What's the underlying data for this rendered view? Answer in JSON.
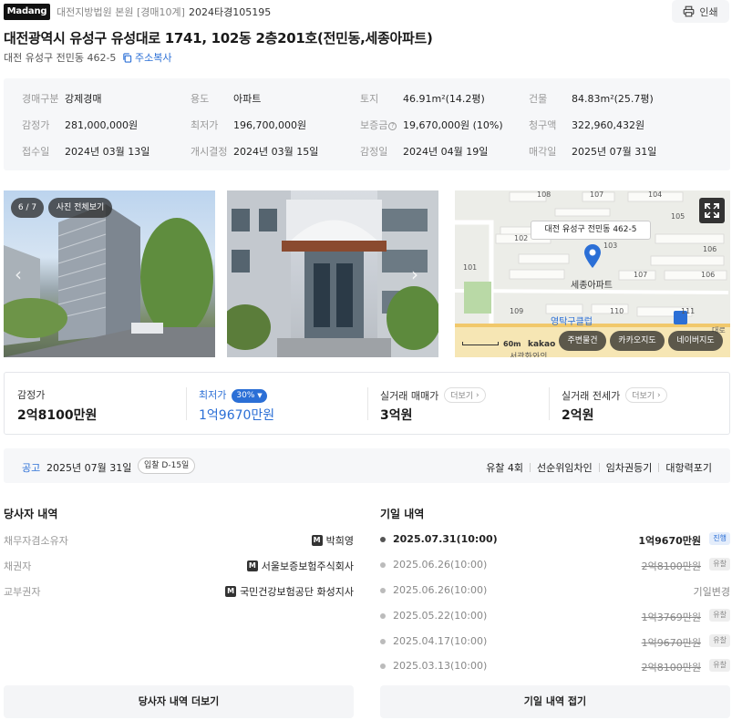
{
  "header": {
    "logo_text": "Madang",
    "court": "대전지방법원 본원 [경매10계]",
    "case_no": "2024타경105195",
    "print_label": "인쇄"
  },
  "title": "대전광역시 유성구 유성대로 1741, 102동 2층201호(전민동,세종아파트)",
  "sub_address": "대전 유성구 전민동 462-5",
  "copy_label": "주소복사",
  "info": {
    "row1": [
      {
        "label": "경매구분",
        "value": "강제경매"
      },
      {
        "label": "용도",
        "value": "아파트"
      },
      {
        "label": "토지",
        "value": "46.91m²(14.2평)"
      },
      {
        "label": "건물",
        "value": "84.83m²(25.7평)"
      }
    ],
    "row2": [
      {
        "label": "감정가",
        "value": "281,000,000원"
      },
      {
        "label": "최저가",
        "value": "196,700,000원"
      },
      {
        "label": "보증금",
        "value": "19,670,000원 (10%)"
      },
      {
        "label": "청구액",
        "value": "322,960,432원"
      }
    ],
    "row3": [
      {
        "label": "접수일",
        "value": "2024년 03월 13일"
      },
      {
        "label": "개시결정",
        "value": "2024년 03월 15일"
      },
      {
        "label": "감정일",
        "value": "2024년 04월 19일"
      },
      {
        "label": "매각일",
        "value": "2025년 07월 31일"
      }
    ]
  },
  "photos": {
    "counter": "6 / 7",
    "view_all": "사진 전체보기"
  },
  "map": {
    "callout": "대전 유성구 전민동 462-5",
    "place": "세종아파트",
    "poi": "영탁구클럽",
    "poi2": "서광화와의",
    "scale": "60m",
    "provider": "kakao",
    "btn_nearby": "주변물건",
    "btn_kakao": "카카오지도",
    "btn_naver": "네이버지도",
    "labels": [
      "108",
      "107",
      "104",
      "105",
      "102",
      "106",
      "101",
      "103",
      "107",
      "106",
      "109",
      "110",
      "111",
      "대로"
    ]
  },
  "prices": {
    "appraisal": {
      "label": "감정가",
      "value": "2억8100만원"
    },
    "minimum": {
      "label": "최저가",
      "pct": "30%",
      "value": "1억9670만원"
    },
    "sale": {
      "label": "실거래 매매가",
      "more": "더보기",
      "value": "3억원"
    },
    "lease": {
      "label": "실거래 전세가",
      "more": "더보기",
      "value": "2억원"
    }
  },
  "notice": {
    "label": "공고",
    "date": "2025년 07월 31일",
    "dday": "입찰 D-15일",
    "tags": [
      "유찰 4회",
      "선순위임차인",
      "임차권등기",
      "대항력포기"
    ]
  },
  "parties": {
    "title": "당사자 내역",
    "rows": [
      {
        "k": "채무자겸소유자",
        "badge": "M",
        "v": "박희영"
      },
      {
        "k": "채권자",
        "badge": "M",
        "v": "서울보증보험주식회사"
      },
      {
        "k": "교부권자",
        "badge": "M",
        "v": "국민건강보험공단 화성지사"
      }
    ],
    "more_button": "당사자 내역 더보기"
  },
  "history": {
    "title": "기일 내역",
    "rows": [
      {
        "date": "2025.07.31(10:00)",
        "amount": "1억9670만원",
        "status": "진행"
      },
      {
        "date": "2025.06.26(10:00)",
        "amount": "2억8100만원",
        "status": "유찰"
      },
      {
        "date": "2025.06.26(10:00)",
        "amount": "기일변경",
        "status": ""
      },
      {
        "date": "2025.05.22(10:00)",
        "amount": "1억3769만원",
        "status": "유찰"
      },
      {
        "date": "2025.04.17(10:00)",
        "amount": "1억9670만원",
        "status": "유찰"
      },
      {
        "date": "2025.03.13(10:00)",
        "amount": "2억8100만원",
        "status": "유찰"
      }
    ],
    "collapse_button": "기일 내역 접기"
  },
  "colors": {
    "accent": "#2b6fd6",
    "panel": "#f6f7f9"
  }
}
